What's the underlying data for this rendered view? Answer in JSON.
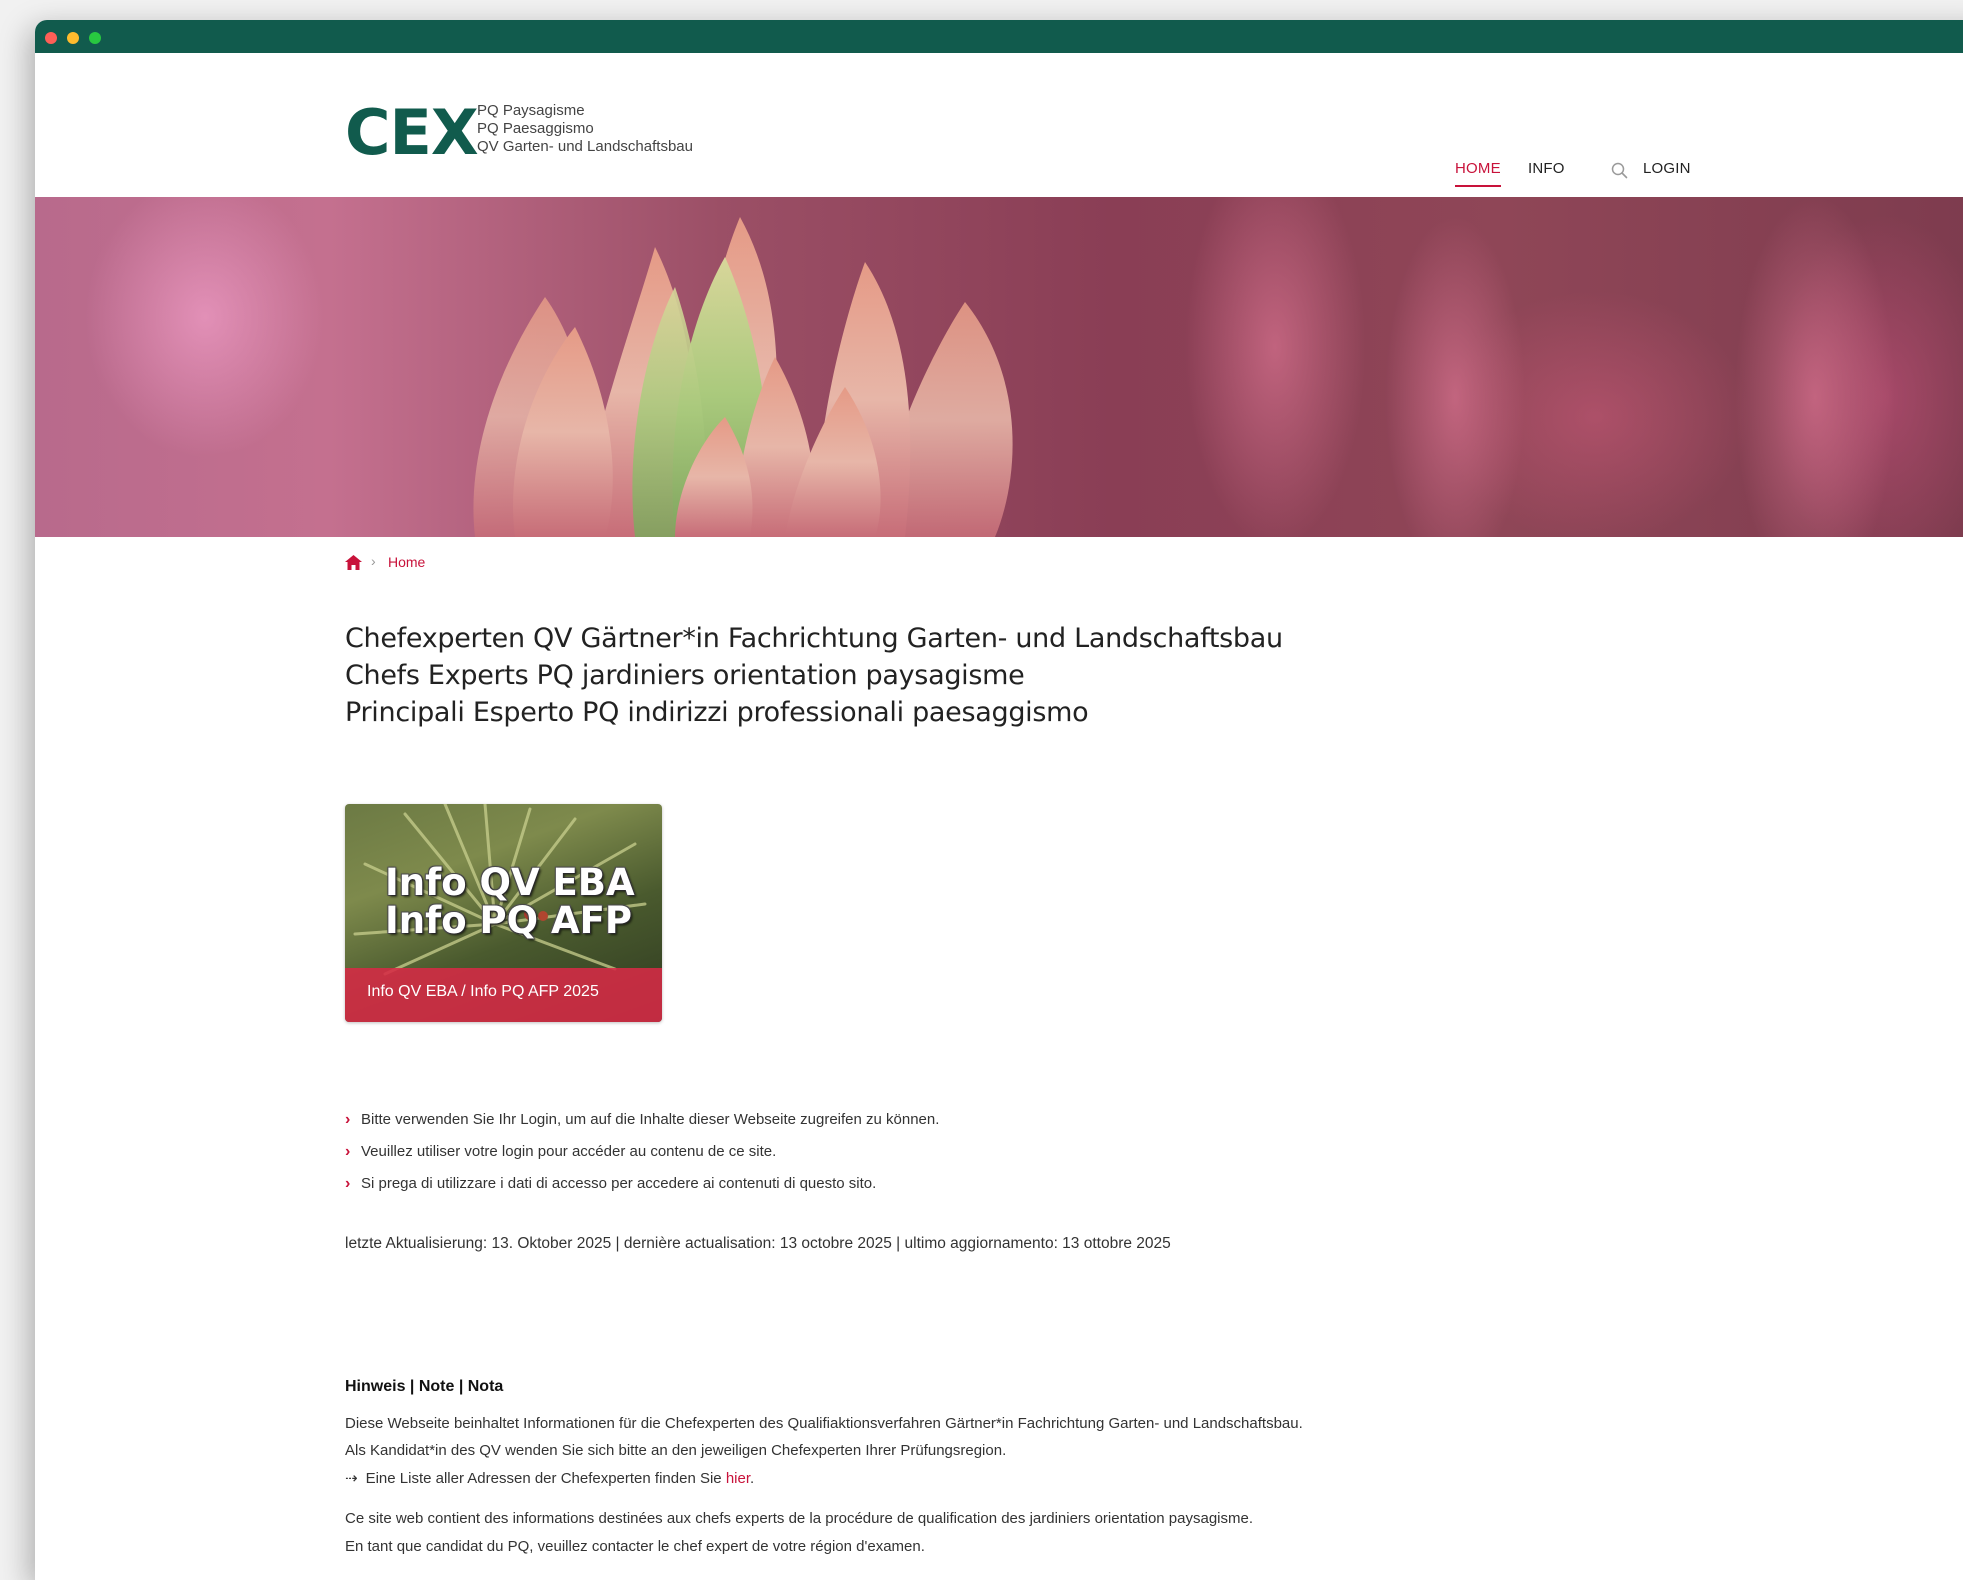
{
  "window": {
    "titlebar_color": "#115b4d"
  },
  "header": {
    "logo_text": "CEX",
    "logo_lines": [
      "PQ Paysagisme",
      "PQ Paesaggismo",
      "QV Garten- und Landschaftsbau"
    ],
    "nav": {
      "home": "HOME",
      "info": "INFO",
      "login": "LOGIN"
    }
  },
  "breadcrumb": {
    "current": "Home"
  },
  "page_title": {
    "line1": "Chefexperten QV Gärtner*in Fachrichtung Garten- und Landschaftsbau",
    "line2": "Chefs Experts PQ jardiniers orientation paysagisme",
    "line3": "Principali Esperto PQ indirizzi professionali paesaggismo"
  },
  "card": {
    "title_line1": "Info QV EBA",
    "title_line2": "Info PQ AFP",
    "caption": "Info QV EBA / Info PQ AFP 2025"
  },
  "notices": [
    "Bitte verwenden Sie Ihr Login, um auf die Inhalte dieser Webseite zugreifen zu können.",
    "Veuillez utiliser votre login pour accéder au contenu de ce site.",
    "Si prega di utilizzare i dati di accesso per accedere ai contenuti di questo sito."
  ],
  "updated": "letzte Aktualisierung: 13. Oktober 2025 | dernière actualisation: 13 octobre 2025 | ultimo aggiornamento: 13 ottobre 2025",
  "note": {
    "title": "Hinweis | Note | Nota",
    "de_line1": "Diese Webseite beinhaltet Informationen für die Chefexperten des Qualifiaktionsverfahren Gärtner*in Fachrichtung Garten- und Landschaftsbau.",
    "de_line2": "Als Kandidat*in des QV wenden Sie sich bitte an den jeweiligen Chefexperten Ihrer Prüfungsregion.",
    "de_line3_arrow": "⇢",
    "de_line3_text": "Eine Liste aller Adressen der Chefexperten finden Sie ",
    "de_line3_link": "hier",
    "de_line3_end": ".",
    "fr_line1": "Ce site web contient des informations destinées aux chefs experts de la procédure de qualification des jardiniers orientation paysagisme.",
    "fr_line2": "En tant que candidat du PQ, veuillez contacter le chef expert de votre région d'examen."
  },
  "colors": {
    "accent": "#c8123a",
    "brand": "#115b4d"
  },
  "icons": [
    "search-icon",
    "home-icon",
    "chevron-right-icon"
  ]
}
